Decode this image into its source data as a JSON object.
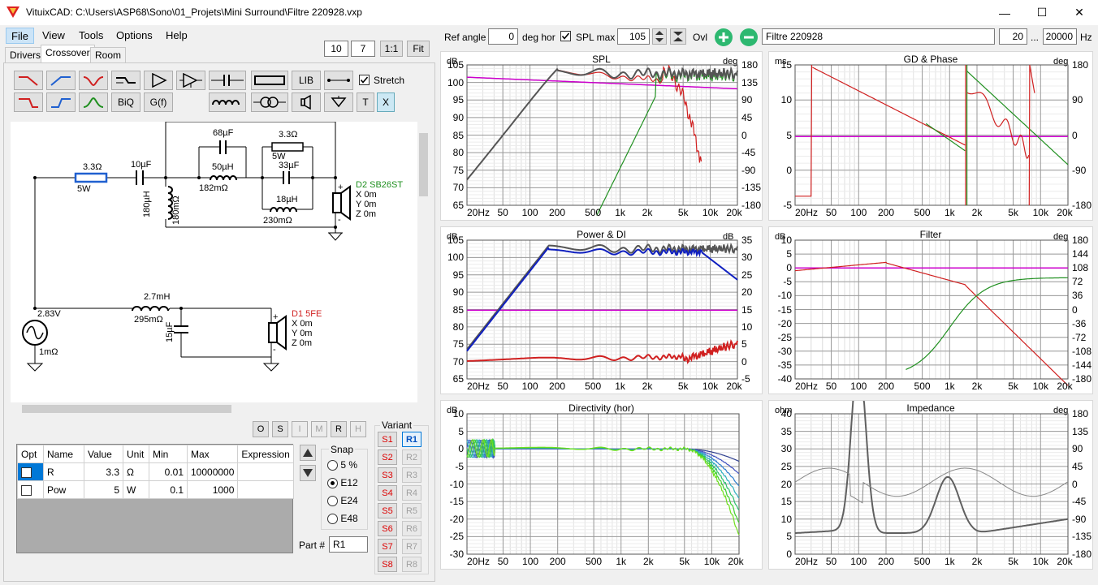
{
  "window": {
    "title": "VituixCAD: C:\\Users\\ASP68\\Sono\\01_Projets\\Mini Surround\\Filtre 220928.vxp",
    "minimize": "—",
    "maximize": "☐",
    "close": "✕"
  },
  "menu": [
    "File",
    "View",
    "Tools",
    "Options",
    "Help"
  ],
  "zoom_buttons": {
    "a": "10",
    "b": "7",
    "c": "1:1",
    "d": "Fit"
  },
  "tabs": [
    "Drivers",
    "Crossover",
    "Room"
  ],
  "toolbar": {
    "lib": "LIB",
    "biq": "BiQ",
    "gf": "G(f)",
    "t": "T",
    "x": "X",
    "stretch": "Stretch"
  },
  "schematic": {
    "r1": "3.3Ω",
    "r1_pow": "5W",
    "c1": "10µF",
    "c2": "68µF",
    "r2": "3.3Ω",
    "r2_pow": "5W",
    "l1": "50µH",
    "l1_r": "182mΩ",
    "c3": "33µF",
    "l2": "18µH",
    "l2_r": "230mΩ",
    "l_shunt": "180µH",
    "l_shunt_r": "180mΩ",
    "d2_name": "D2 SB26ST",
    "d2_x": "X 0m",
    "d2_y": "Y 0m",
    "d2_z": "Z 0m",
    "src_v": "2.83V",
    "src_r": "1mΩ",
    "l3": "2.7mH",
    "l3_r": "295mΩ",
    "c4": "15µF",
    "d1_name": "D1 5FE",
    "d1_x": "X 0m",
    "d1_y": "Y 0m",
    "d1_z": "Z 0m"
  },
  "part_buttons": [
    "O",
    "S",
    "I",
    "M",
    "R",
    "H"
  ],
  "params": {
    "headers": [
      "Opt",
      "Name",
      "Value",
      "Unit",
      "Min",
      "Max",
      "Expression"
    ],
    "rows": [
      {
        "name": "R",
        "value": "3.3",
        "unit": "Ω",
        "min": "0.01",
        "max": "10000000"
      },
      {
        "name": "Pow",
        "value": "5",
        "unit": "W",
        "min": "0.1",
        "max": "1000"
      }
    ]
  },
  "snap": {
    "label": "Snap",
    "options": [
      "5 %",
      "E12",
      "E24",
      "E48"
    ],
    "selected": "E12"
  },
  "part_no": {
    "label": "Part #",
    "value": "R1"
  },
  "variant": {
    "label": "Variant",
    "s": [
      "S1",
      "S2",
      "S3",
      "S4",
      "S5",
      "S6",
      "S7",
      "S8"
    ],
    "r": [
      "R1",
      "R2",
      "R3",
      "R4",
      "R5",
      "R6",
      "R7",
      "R8"
    ]
  },
  "topbar": {
    "ref_angle_label": "Ref angle",
    "ref_angle": "0",
    "deg_hor": "deg hor",
    "spl_max_label": "SPL max",
    "spl_max": "105",
    "ovl": "Ovl",
    "filename": "Filtre 220928",
    "f_min": "20",
    "dots": "...",
    "f_max": "20000",
    "hz": "Hz"
  },
  "freq_ticks": [
    "20Hz",
    "50",
    "100",
    "200",
    "500",
    "1k",
    "2k",
    "5k",
    "10k",
    "20k"
  ],
  "panels": {
    "spl": {
      "title": "SPL",
      "unit_l": "dB",
      "unit_r": "deg",
      "left": [
        "105",
        "100",
        "95",
        "90",
        "85",
        "80",
        "75",
        "70",
        "65"
      ],
      "right": [
        "180",
        "135",
        "90",
        "45",
        "0",
        "-45",
        "-90",
        "-135",
        "-180"
      ]
    },
    "gd": {
      "title": "GD & Phase",
      "unit_l": "ms",
      "unit_r": "deg",
      "left": [
        "15",
        "10",
        "5",
        "0",
        "-5"
      ],
      "right": [
        "180",
        "90",
        "0",
        "-90",
        "-180"
      ]
    },
    "power": {
      "title": "Power & DI",
      "unit_l": "dB",
      "unit_r": "dB",
      "left": [
        "105",
        "100",
        "95",
        "90",
        "85",
        "80",
        "75",
        "70",
        "65"
      ],
      "right": [
        "35",
        "30",
        "25",
        "20",
        "15",
        "10",
        "5",
        "0",
        "-5"
      ]
    },
    "filter": {
      "title": "Filter",
      "unit_l": "dB",
      "unit_r": "deg",
      "left": [
        "10",
        "5",
        "0",
        "-5",
        "-10",
        "-15",
        "-20",
        "-25",
        "-30",
        "-35",
        "-40"
      ],
      "right": [
        "180",
        "144",
        "108",
        "72",
        "36",
        "0",
        "-36",
        "-72",
        "-108",
        "-144",
        "-180"
      ]
    },
    "dir": {
      "title": "Directivity (hor)",
      "unit_l": "dB",
      "left": [
        "10",
        "5",
        "0",
        "-5",
        "-10",
        "-15",
        "-20",
        "-25",
        "-30"
      ]
    },
    "imp": {
      "title": "Impedance",
      "unit_l": "ohm",
      "unit_r": "deg",
      "left": [
        "40",
        "35",
        "30",
        "25",
        "20",
        "15",
        "10",
        "5",
        "0"
      ],
      "right": [
        "180",
        "135",
        "90",
        "45",
        "0",
        "-45",
        "-90",
        "-135",
        "-180"
      ]
    }
  },
  "colors": {
    "woofer": "#d02020",
    "tweeter": "#209020",
    "sum": "#555555",
    "target": "#cc00cc",
    "power": "#1020c0"
  }
}
